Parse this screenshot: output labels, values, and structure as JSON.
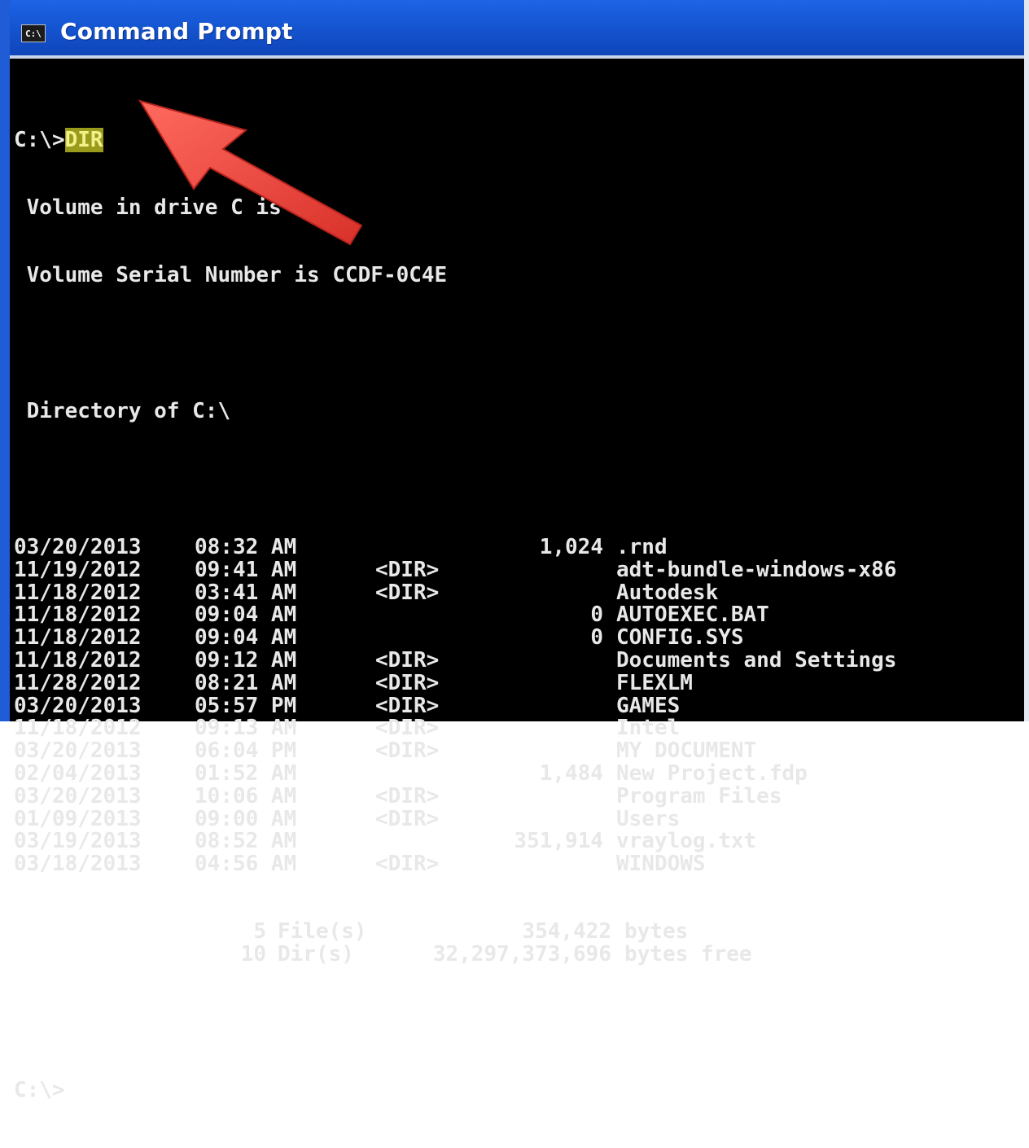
{
  "window": {
    "title": "Command Prompt",
    "icon": "C:\\",
    "icon_name": "console-icon"
  },
  "colors": {
    "titlebar": "#1556d3",
    "console_bg": "#000000",
    "console_fg": "#e8e8e8",
    "highlight_bg": "#9a9a1c",
    "arrow": "#e8433c"
  },
  "console": {
    "prompt": "C:\\>",
    "command": "DIR",
    "header_lines": [
      " Volume in drive C is A",
      " Volume Serial Number is CCDF-0C4E",
      "",
      " Directory of C:\\"
    ],
    "entries": [
      {
        "date": "03/20/2013",
        "time": "08:32 AM",
        "dir": "",
        "size": "1,024",
        "name": ".rnd"
      },
      {
        "date": "11/19/2012",
        "time": "09:41 AM",
        "dir": "<DIR>",
        "size": "",
        "name": "adt-bundle-windows-x86"
      },
      {
        "date": "11/18/2012",
        "time": "03:41 AM",
        "dir": "<DIR>",
        "size": "",
        "name": "Autodesk"
      },
      {
        "date": "11/18/2012",
        "time": "09:04 AM",
        "dir": "",
        "size": "0",
        "name": "AUTOEXEC.BAT"
      },
      {
        "date": "11/18/2012",
        "time": "09:04 AM",
        "dir": "",
        "size": "0",
        "name": "CONFIG.SYS"
      },
      {
        "date": "11/18/2012",
        "time": "09:12 AM",
        "dir": "<DIR>",
        "size": "",
        "name": "Documents and Settings"
      },
      {
        "date": "11/28/2012",
        "time": "08:21 AM",
        "dir": "<DIR>",
        "size": "",
        "name": "FLEXLM"
      },
      {
        "date": "03/20/2013",
        "time": "05:57 PM",
        "dir": "<DIR>",
        "size": "",
        "name": "GAMES"
      },
      {
        "date": "11/18/2012",
        "time": "09:13 AM",
        "dir": "<DIR>",
        "size": "",
        "name": "Intel"
      },
      {
        "date": "03/20/2013",
        "time": "06:04 PM",
        "dir": "<DIR>",
        "size": "",
        "name": "MY DOCUMENT"
      },
      {
        "date": "02/04/2013",
        "time": "01:52 AM",
        "dir": "",
        "size": "1,484",
        "name": "New Project.fdp"
      },
      {
        "date": "03/20/2013",
        "time": "10:06 AM",
        "dir": "<DIR>",
        "size": "",
        "name": "Program Files"
      },
      {
        "date": "01/09/2013",
        "time": "09:00 AM",
        "dir": "<DIR>",
        "size": "",
        "name": "Users"
      },
      {
        "date": "03/19/2013",
        "time": "08:52 AM",
        "dir": "",
        "size": "351,914",
        "name": "vraylog.txt"
      },
      {
        "date": "03/18/2013",
        "time": "04:56 AM",
        "dir": "<DIR>",
        "size": "",
        "name": "WINDOWS"
      }
    ],
    "summary": [
      {
        "count": "5",
        "label": "File(s)",
        "bytes": "354,422",
        "unit": "bytes"
      },
      {
        "count": "10",
        "label": "Dir(s)",
        "bytes": "32,297,373,696",
        "unit": "bytes free"
      }
    ],
    "final_prompt": "C:\\>"
  },
  "annotation": {
    "icon_name": "red-arrow-icon"
  }
}
